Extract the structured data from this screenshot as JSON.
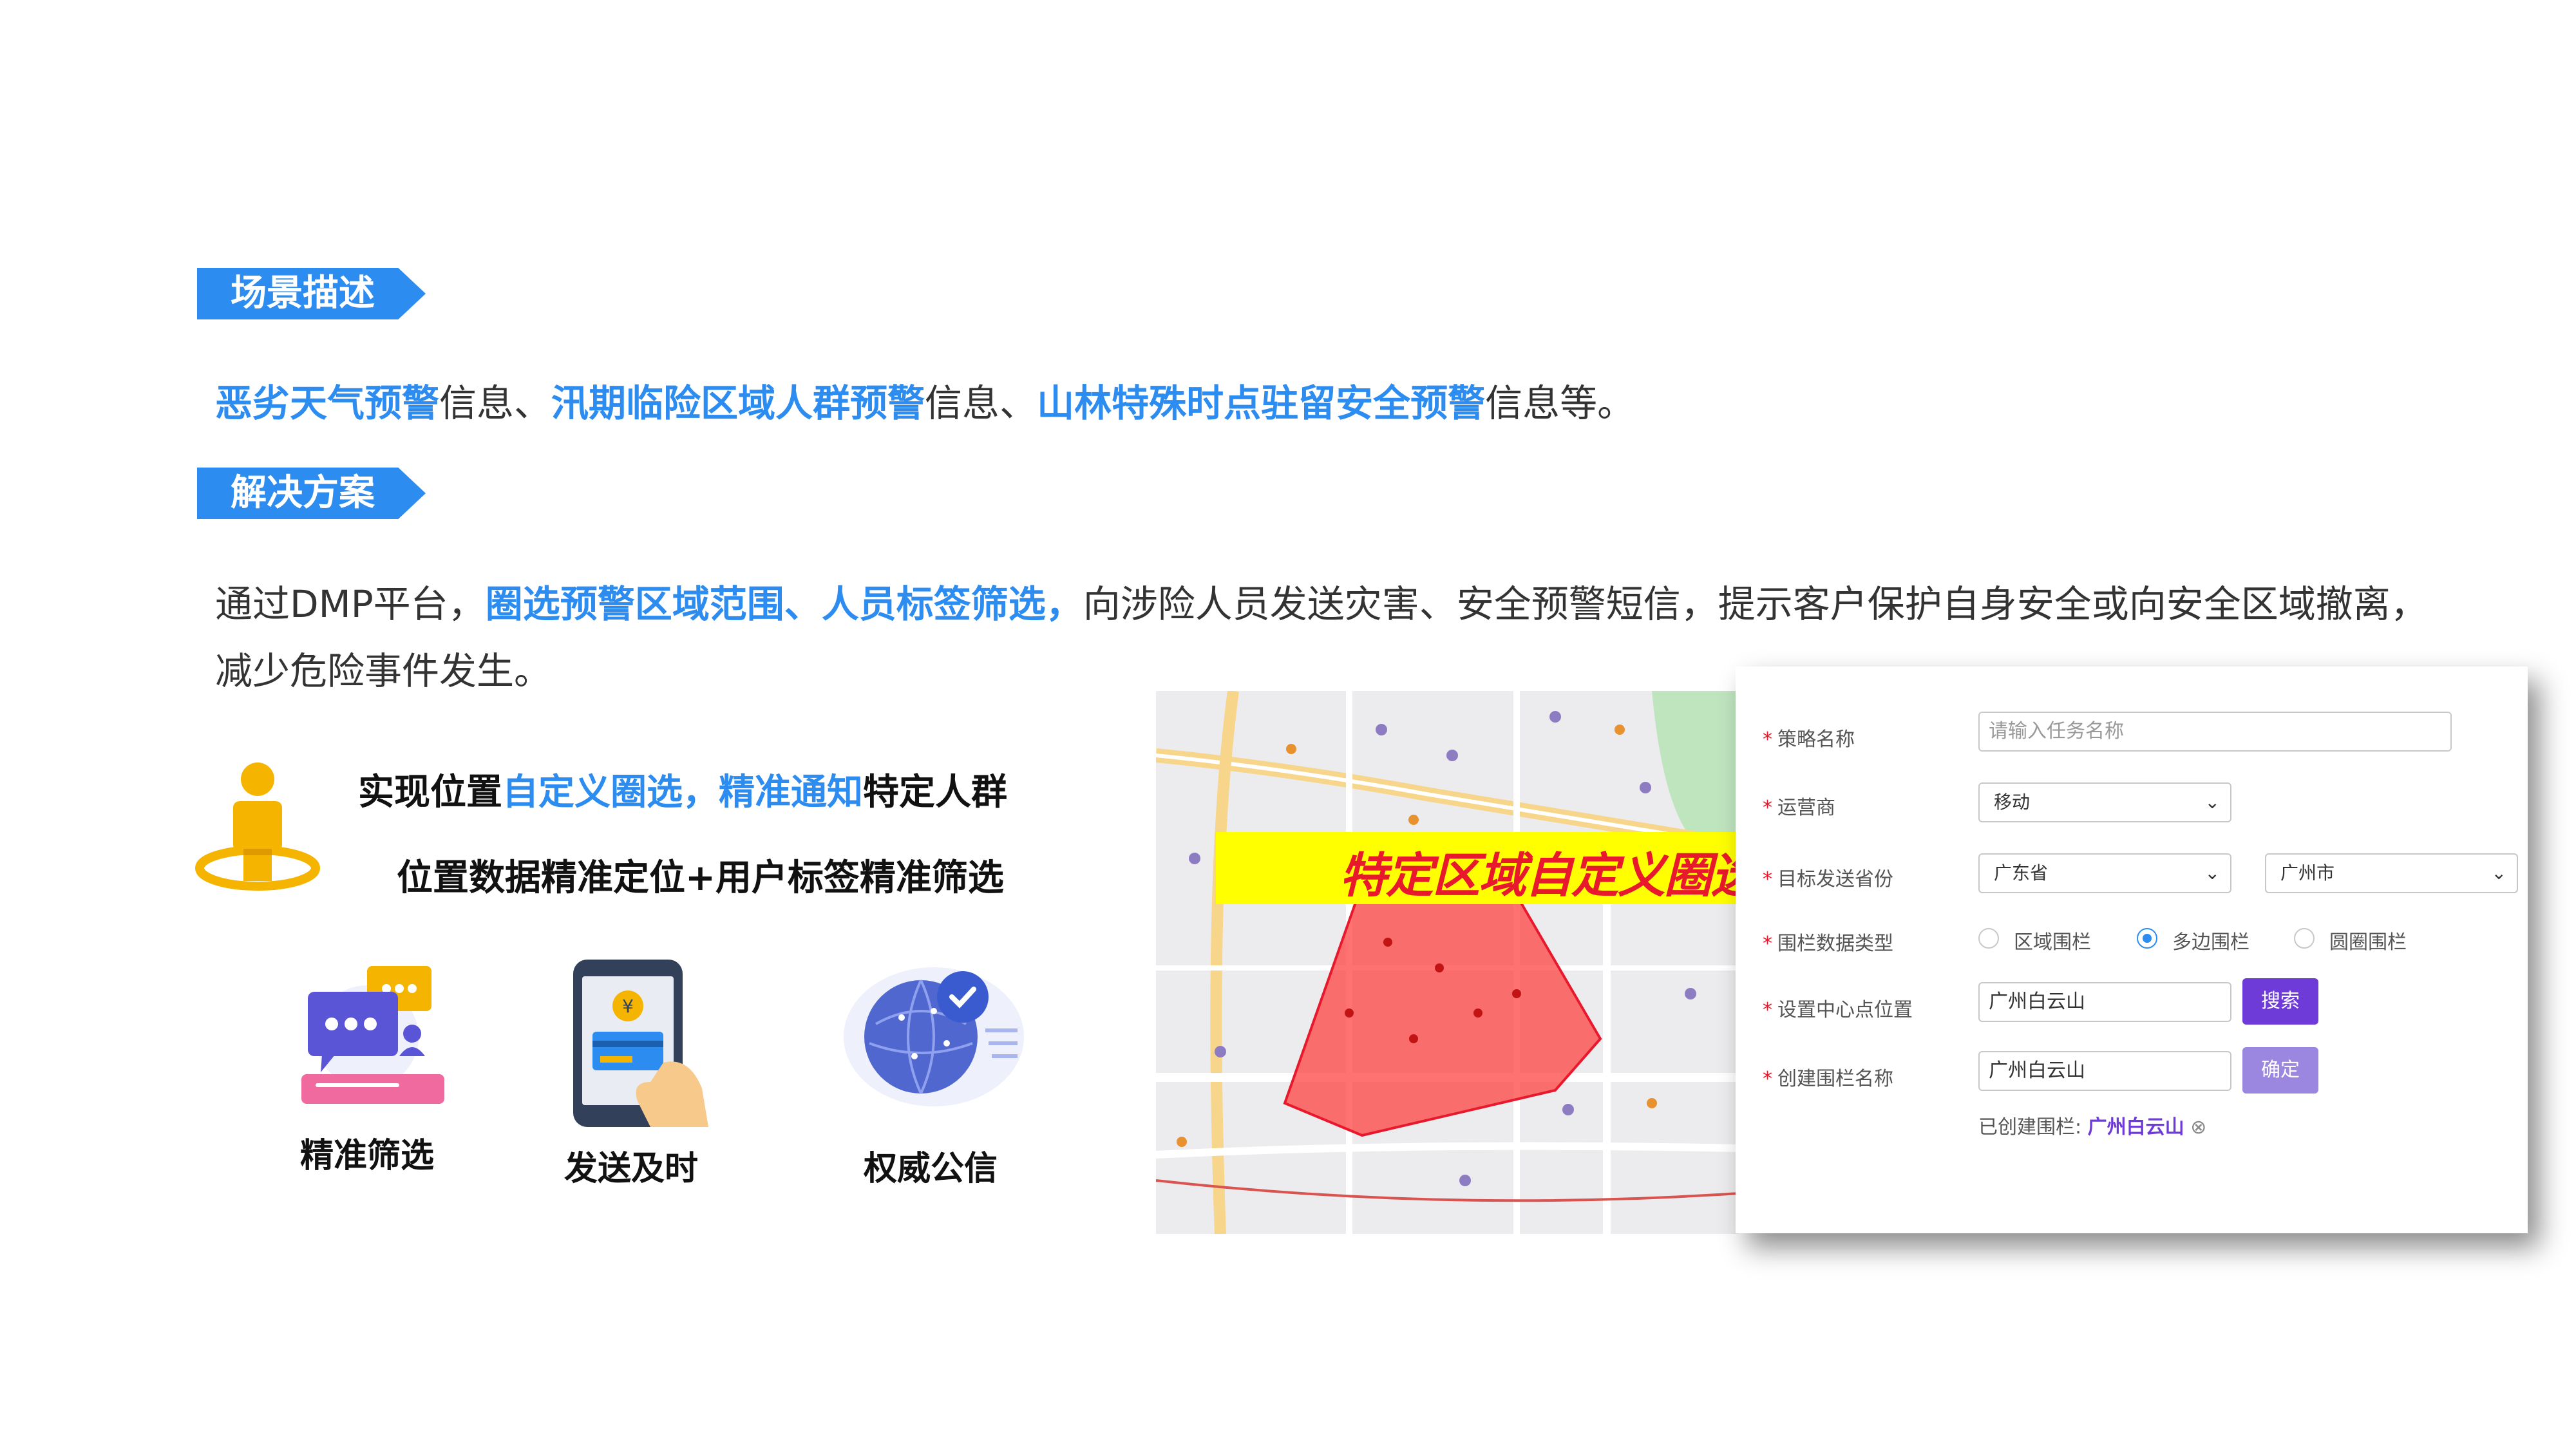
{
  "section1": {
    "tag": "场景描述"
  },
  "scenario": {
    "hl1": "恶劣天气预警",
    "t1": "信息、",
    "hl2": "汛期临险区域人群预警",
    "t2": "信息、",
    "hl3": "山林特殊时点驻留安全预警",
    "t3": "信息等。"
  },
  "section2": {
    "tag": "解决方案"
  },
  "solution": {
    "t1": "通过DMP平台，",
    "hl1": "圈选预警区域范围、人员标签筛选，",
    "t2": "向涉险人员发送灾害、安全预警短信，提示客户保护自身安全或向安全区域撤离，",
    "t3": "减少危险事件发生。"
  },
  "feature": {
    "line1_a": "实现位置",
    "line1_hl": "自定义圈选，精准通知",
    "line1_b": "特定人群",
    "line2": "位置数据精准定位+用户标签精准筛选",
    "items": [
      {
        "label": "精准筛选",
        "icon": "chat-filter-icon"
      },
      {
        "label": "发送及时",
        "icon": "phone-payment-icon"
      },
      {
        "label": "权威公信",
        "icon": "globe-check-icon"
      }
    ]
  },
  "map": {
    "banner": "特定区域自定义圈选",
    "banner_bg": "#ffff00",
    "banner_color": "#e8192c",
    "polygon_color": "#ff3b3b"
  },
  "form": {
    "strategy_label": "策略名称",
    "strategy_placeholder": "请输入任务名称",
    "operator_label": "运营商",
    "operator_value": "移动",
    "province_label": "目标发送省份",
    "province_value": "广东省",
    "city_value": "广州市",
    "fence_type_label": "围栏数据类型",
    "fence_options": [
      "区域围栏",
      "多边围栏",
      "圆圈围栏"
    ],
    "fence_selected": "多边围栏",
    "center_label": "设置中心点位置",
    "center_value": "广州白云山",
    "search_button": "搜索",
    "name_label": "创建围栏名称",
    "name_value": "广州白云山",
    "confirm_button": "确定",
    "created_prefix": "已创建围栏:",
    "created_value": "广州白云山",
    "accent": "#6f3bd8"
  },
  "colors": {
    "accent": "#2d8cf0"
  }
}
